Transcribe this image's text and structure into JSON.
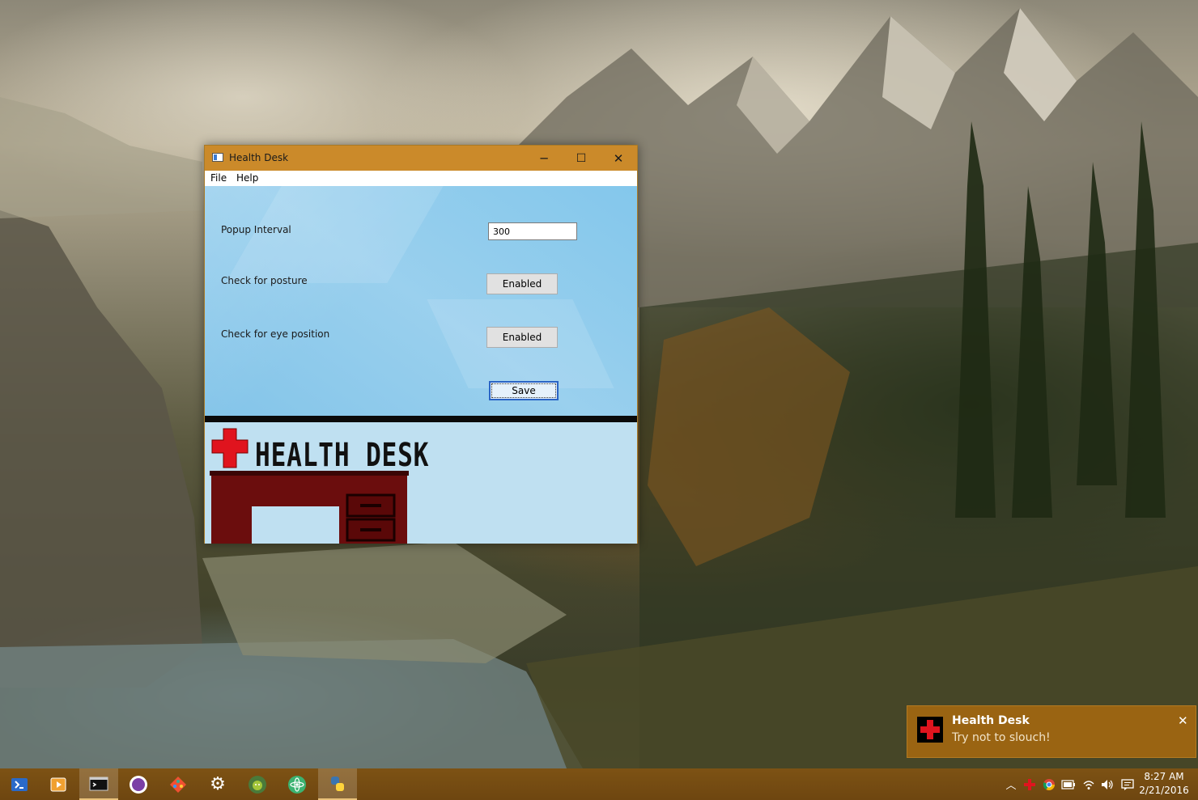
{
  "window": {
    "title": "Health Desk",
    "minimize_glyph": "─",
    "maximize_glyph": "☐",
    "close_glyph": "✕",
    "menu": [
      {
        "label": "File"
      },
      {
        "label": "Help"
      }
    ]
  },
  "settings": {
    "popup_interval_label": "Popup Interval",
    "popup_interval_value": "300",
    "posture_label": "Check for posture",
    "posture_button": "Enabled",
    "eye_label": "Check for eye position",
    "eye_button": "Enabled",
    "save_button": "Save"
  },
  "logo": {
    "text": "HEALTH DESK"
  },
  "toast": {
    "title": "Health Desk",
    "message": "Try not to slouch!",
    "close_glyph": "✕"
  },
  "taskbar": {
    "icons": [
      "powershell-icon",
      "media-player-icon",
      "terminal-icon",
      "visual-studio-icon",
      "git-icon",
      "settings-gear-icon",
      "android-studio-icon",
      "atom-icon",
      "python-icon"
    ],
    "clock_time": "8:27 AM",
    "clock_date": "2/21/2016"
  },
  "colors": {
    "titlebar": "#cb8a2a",
    "taskbar": "#7a4d10",
    "toast": "#9a6412",
    "logo_red": "#e0141e",
    "desk": "#6b0d0d"
  }
}
